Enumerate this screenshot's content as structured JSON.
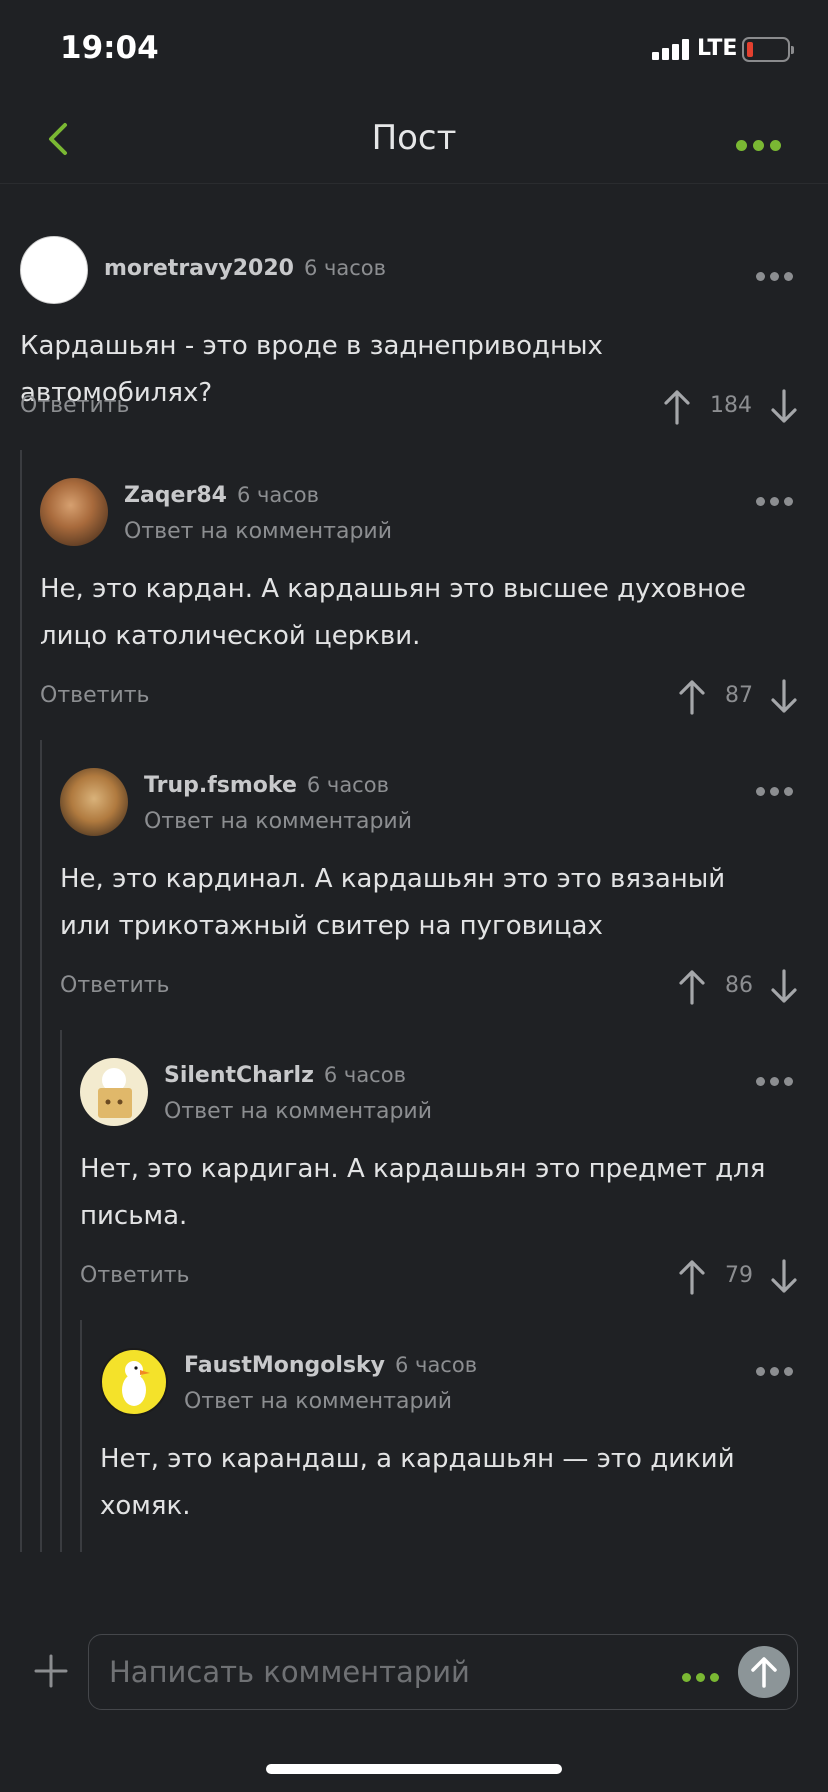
{
  "status_bar": {
    "time": "19:04",
    "network": "LTE",
    "battery_level": 0.1
  },
  "nav": {
    "title": "Пост"
  },
  "comments": [
    {
      "author": "moretravy2020",
      "time": "6 часов",
      "reply_to": "",
      "text": "Кардашьян - это вроде в заднеприводных автомобилях?",
      "reply_label": "Ответить",
      "votes": "184"
    },
    {
      "author": "Zaqer84",
      "time": "6 часов",
      "reply_to": "Ответ на комментарий",
      "text": "Не, это кардан. А кардашьян это высшее духовное лицо католической церкви.",
      "reply_label": "Ответить",
      "votes": "87"
    },
    {
      "author": "Trup.fsmoke",
      "time": "6 часов",
      "reply_to": "Ответ на комментарий",
      "text": "Не, это кардинал. А кардашьян это это вязаный или трикотажный свитер на пуговицах",
      "reply_label": "Ответить",
      "votes": "86"
    },
    {
      "author": "SilentCharlz",
      "time": "6 часов",
      "reply_to": "Ответ на комментарий",
      "text": "Нет, это кардиган. А кардашьян это предмет для письма.",
      "reply_label": "Ответить",
      "votes": "79"
    },
    {
      "author": "FaustMongolsky",
      "time": "6 часов",
      "reply_to": "Ответ на комментарий",
      "text": "Нет, это карандаш, а кардашьян — это дикий хомяк.",
      "reply_label": "",
      "votes": ""
    }
  ],
  "composer": {
    "placeholder": "Написать комментарий"
  },
  "icons": {
    "back": "chevron-left-icon",
    "more": "more-dots-icon",
    "upvote": "arrow-up-icon",
    "downvote": "arrow-down-icon",
    "plus": "plus-icon",
    "send": "send-arrow-icon"
  },
  "colors": {
    "accent": "#7ab833",
    "background": "#1f2124",
    "muted": "#8c8e91"
  }
}
